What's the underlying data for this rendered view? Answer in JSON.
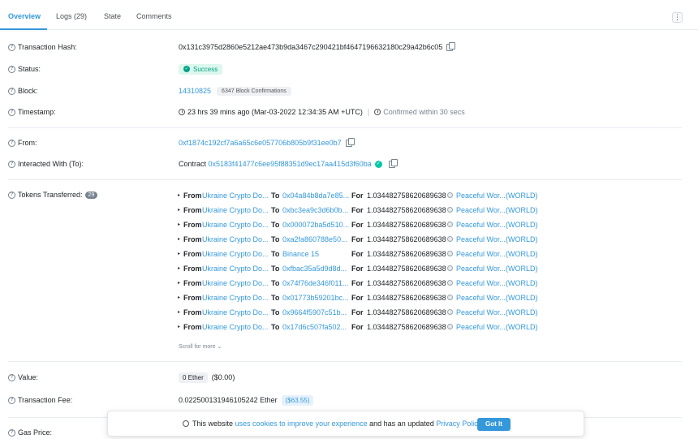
{
  "tabs": [
    {
      "label": "Overview"
    },
    {
      "label": "Logs (29)"
    },
    {
      "label": "State"
    },
    {
      "label": "Comments"
    }
  ],
  "kebab_label": "⋮",
  "fields": {
    "hash": {
      "label": "Transaction Hash:",
      "value": "0x131c3975d2860e5212ae473b9da3467c290421bf4647196632180c29a42b6c05"
    },
    "status": {
      "label": "Status:",
      "value": "Success"
    },
    "block": {
      "label": "Block:",
      "number": "14310825",
      "confirmations": "6347 Block Confirmations"
    },
    "timestamp": {
      "label": "Timestamp:",
      "value": "23 hrs 39 mins ago (Mar-03-2022 12:34:35 AM +UTC)",
      "separator": "|",
      "confirmed": "Confirmed within 30 secs"
    },
    "from": {
      "label": "From:",
      "value": "0xf1874c192cf7a6a65c6e057706b805b9f31ee0b7"
    },
    "to": {
      "label": "Interacted With (To):",
      "prefix": "Contract",
      "value": "0x5183f41477c6ee95f88351d9ec17aa415d3f60ba"
    },
    "tokens": {
      "label": "Tokens Transferred:",
      "count": "29"
    },
    "value": {
      "label": "Value:",
      "ether": "0 Ether",
      "usd": "($0.00)"
    },
    "fee": {
      "label": "Transaction Fee:",
      "value": "0.022500131946105242 Ether",
      "usd": "($63.55)"
    },
    "gas": {
      "label": "Gas Price:"
    }
  },
  "transfer_keywords": {
    "from": "From",
    "to": "To",
    "for": "For",
    "arrow": "▸"
  },
  "transfers": [
    {
      "from": "Ukraine Crypto Do...",
      "to": "0x04a84b8da7e85...",
      "amount": "1.034482758620689638",
      "token": "Peaceful Wor...",
      "symbol": "(WORLD)"
    },
    {
      "from": "Ukraine Crypto Do...",
      "to": "0xbc3ea9c3d6b0b...",
      "amount": "1.034482758620689638",
      "token": "Peaceful Wor...",
      "symbol": "(WORLD)"
    },
    {
      "from": "Ukraine Crypto Do...",
      "to": "0x000072ba5d510...",
      "amount": "1.034482758620689638",
      "token": "Peaceful Wor...",
      "symbol": "(WORLD)"
    },
    {
      "from": "Ukraine Crypto Do...",
      "to": "0xa2fa860788e50...",
      "amount": "1.034482758620689638",
      "token": "Peaceful Wor...",
      "symbol": "(WORLD)"
    },
    {
      "from": "Ukraine Crypto Do...",
      "to": "Binance 15",
      "amount": "1.034482758620689638",
      "token": "Peaceful Wor...",
      "symbol": "(WORLD)"
    },
    {
      "from": "Ukraine Crypto Do...",
      "to": "0xfbac35a5d9d8d...",
      "amount": "1.034482758620689638",
      "token": "Peaceful Wor...",
      "symbol": "(WORLD)"
    },
    {
      "from": "Ukraine Crypto Do...",
      "to": "0x74f76de346f011...",
      "amount": "1.034482758620689638",
      "token": "Peaceful Wor...",
      "symbol": "(WORLD)"
    },
    {
      "from": "Ukraine Crypto Do...",
      "to": "0x01773b59201bc...",
      "amount": "1.034482758620689638",
      "token": "Peaceful Wor...",
      "symbol": "(WORLD)"
    },
    {
      "from": "Ukraine Crypto Do...",
      "to": "0x9664f5907c51b...",
      "amount": "1.034482758620689638",
      "token": "Peaceful Wor...",
      "symbol": "(WORLD)"
    },
    {
      "from": "Ukraine Crypto Do...",
      "to": "0x17d6c507fa502...",
      "amount": "1.034482758620689638",
      "token": "Peaceful Wor...",
      "symbol": "(WORLD)"
    }
  ],
  "scroll_more": "Scroll for more",
  "scroll_more_icon": "⌄",
  "cookie": {
    "prefix": "This website",
    "link1": "uses cookies to improve your experience",
    "middle": "and has an updated",
    "link2": "Privacy Policy.",
    "button": "Got It"
  }
}
